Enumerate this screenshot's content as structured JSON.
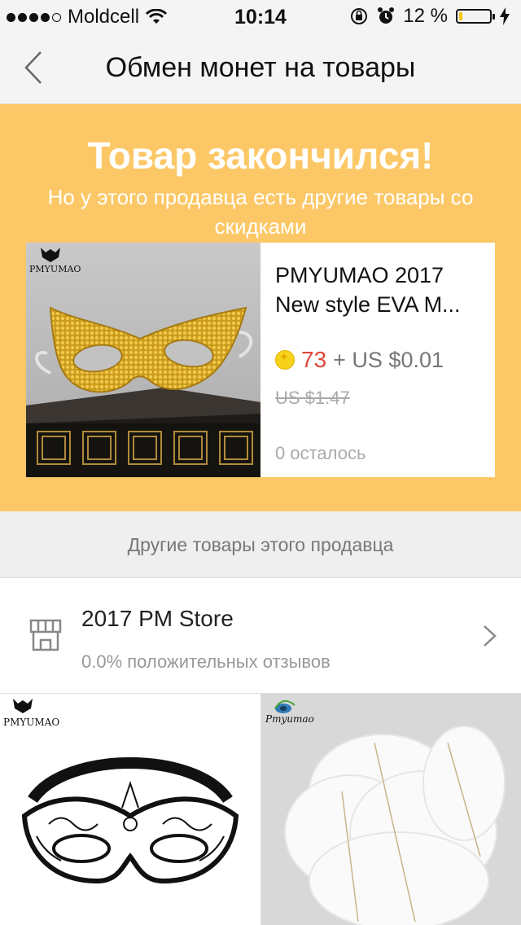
{
  "status_bar": {
    "carrier": "Moldcell",
    "time": "10:14",
    "battery_text": "12 %",
    "battery_level": 0.12
  },
  "nav": {
    "title": "Обмен монет на товары"
  },
  "hero": {
    "title": "Товар закончился!",
    "subtitle": "Но у этого продавца есть другие товары со скидками"
  },
  "product": {
    "name": "PMYUMAO 2017 New style EVA M...",
    "coins": "73",
    "price_extra": "+ US $0.01",
    "old_price": "US $1.47",
    "remaining": "0 осталось",
    "brand": "PMYUMAO"
  },
  "section": {
    "title": "Другие товары этого продавца"
  },
  "store": {
    "name": "2017 PM Store",
    "rating": "0.0% положительных отзывов"
  },
  "thumbs": [
    {
      "brand": "PMYUMAO"
    },
    {
      "brand": "Pmyumao"
    }
  ],
  "colors": {
    "hero_bg": "#fcc867",
    "coins_red": "#e0463a",
    "battery_yellow": "#f5c518"
  }
}
